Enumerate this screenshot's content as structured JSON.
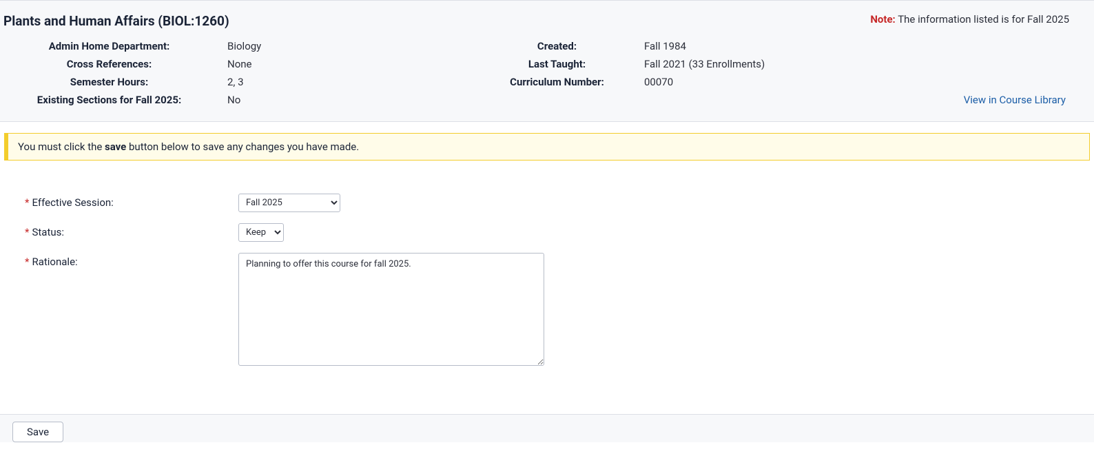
{
  "header": {
    "note_label": "Note:",
    "note_body": "The information listed is for Fall 2025",
    "course_title": "Plants and Human Affairs (BIOL:1260)",
    "fields": {
      "admin_dept_label": "Admin Home Department:",
      "admin_dept_value": "Biology",
      "cross_ref_label": "Cross References:",
      "cross_ref_value": "None",
      "sem_hours_label": "Semester Hours:",
      "sem_hours_value": "2, 3",
      "existing_sections_label": "Existing Sections for Fall 2025:",
      "existing_sections_value": "No",
      "created_label": "Created:",
      "created_value": "Fall 1984",
      "last_taught_label": "Last Taught:",
      "last_taught_value": "Fall 2021 (33 Enrollments)",
      "curriculum_num_label": "Curriculum Number:",
      "curriculum_num_value": "00070"
    },
    "library_link": "View in Course Library"
  },
  "alert": {
    "pre_text": "You must click the ",
    "save_word": "save",
    "post_text": " button below to save any changes you have made."
  },
  "form": {
    "effective_session_label": "Effective Session:",
    "effective_session_value": "Fall 2025",
    "status_label": "Status:",
    "status_value": "Keep",
    "rationale_label": "Rationale:",
    "rationale_value": "Planning to offer this course for fall 2025."
  },
  "footer": {
    "save_button": "Save"
  }
}
